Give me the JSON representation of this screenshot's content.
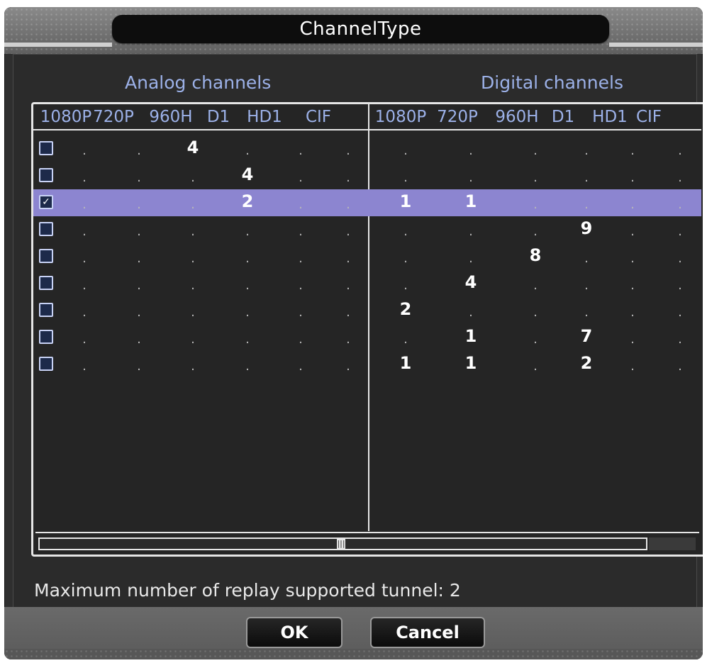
{
  "dialog": {
    "title": "ChannelType",
    "analog_heading": "Analog channels",
    "digital_heading": "Digital channels",
    "analog_columns": [
      "1080P",
      "720P",
      "960H",
      "D1",
      "HD1",
      "CIF"
    ],
    "digital_columns": [
      "1080P",
      "720P",
      "960H",
      "D1",
      "HD1",
      "CIF"
    ],
    "rows": [
      {
        "checked": false,
        "selected": false,
        "analog": [
          ".",
          ".",
          "4",
          ".",
          ".",
          "."
        ],
        "digital": [
          ".",
          ".",
          ".",
          ".",
          ".",
          "."
        ]
      },
      {
        "checked": false,
        "selected": false,
        "analog": [
          ".",
          ".",
          ".",
          "4",
          ".",
          "."
        ],
        "digital": [
          ".",
          ".",
          ".",
          ".",
          ".",
          "."
        ]
      },
      {
        "checked": true,
        "selected": true,
        "analog": [
          ".",
          ".",
          ".",
          "2",
          ".",
          "."
        ],
        "digital": [
          "1",
          "1",
          ".",
          ".",
          ".",
          "."
        ]
      },
      {
        "checked": false,
        "selected": false,
        "analog": [
          ".",
          ".",
          ".",
          ".",
          ".",
          "."
        ],
        "digital": [
          ".",
          ".",
          ".",
          "9",
          ".",
          "."
        ]
      },
      {
        "checked": false,
        "selected": false,
        "analog": [
          ".",
          ".",
          ".",
          ".",
          ".",
          "."
        ],
        "digital": [
          ".",
          ".",
          "8",
          ".",
          ".",
          "."
        ]
      },
      {
        "checked": false,
        "selected": false,
        "analog": [
          ".",
          ".",
          ".",
          ".",
          ".",
          "."
        ],
        "digital": [
          ".",
          "4",
          ".",
          ".",
          ".",
          "."
        ]
      },
      {
        "checked": false,
        "selected": false,
        "analog": [
          ".",
          ".",
          ".",
          ".",
          ".",
          "."
        ],
        "digital": [
          "2",
          ".",
          ".",
          ".",
          ".",
          "."
        ]
      },
      {
        "checked": false,
        "selected": false,
        "analog": [
          ".",
          ".",
          ".",
          ".",
          ".",
          "."
        ],
        "digital": [
          ".",
          "1",
          ".",
          "7",
          ".",
          "."
        ]
      },
      {
        "checked": false,
        "selected": false,
        "analog": [
          ".",
          ".",
          ".",
          ".",
          ".",
          "."
        ],
        "digital": [
          "1",
          "1",
          ".",
          "2",
          ".",
          "."
        ]
      }
    ],
    "status_text": "Maximum number of replay supported tunnel: 2",
    "ok_label": "OK",
    "cancel_label": "Cancel",
    "colors": {
      "heading": "#9cb1e8",
      "selected_row": "#8c85d0",
      "background": "#2b2b2b"
    }
  }
}
